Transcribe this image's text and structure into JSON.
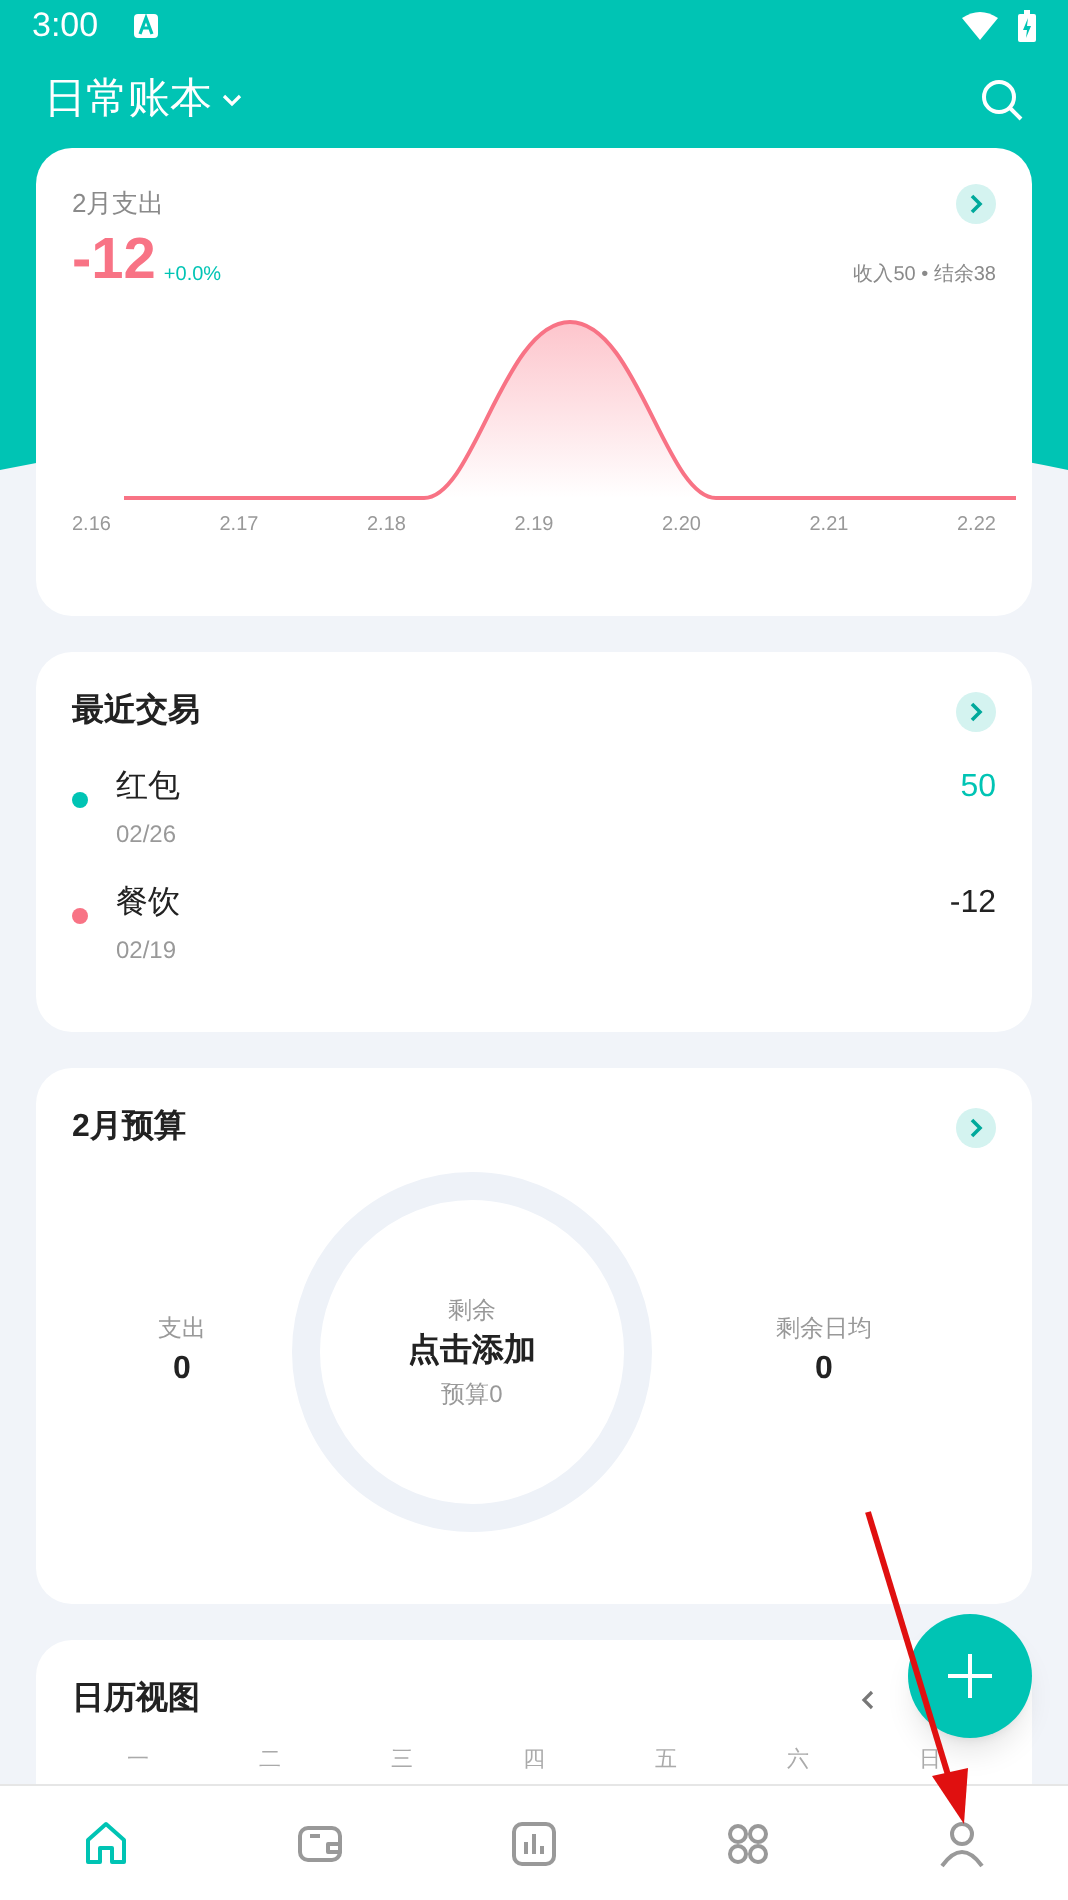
{
  "status_bar": {
    "time": "3:00"
  },
  "header": {
    "title": "日常账本"
  },
  "expense_card": {
    "title": "2月支出",
    "amount": "-12",
    "change": "+0.0%",
    "summary": "收入50 • 结余38",
    "x_labels": [
      "2.16",
      "2.17",
      "2.18",
      "2.19",
      "2.20",
      "2.21",
      "2.22"
    ]
  },
  "recent": {
    "title": "最近交易",
    "items": [
      {
        "name": "红包",
        "date": "02/26",
        "amount": "50",
        "color": "#00c4b4"
      },
      {
        "name": "餐饮",
        "date": "02/19",
        "amount": "-12",
        "color": "#f87385"
      }
    ]
  },
  "budget": {
    "title": "2月预算",
    "left": {
      "label": "支出",
      "value": "0"
    },
    "center": {
      "label": "剩余",
      "action": "点击添加",
      "sub": "预算0"
    },
    "right": {
      "label": "剩余日均",
      "value": "0"
    }
  },
  "calendar": {
    "title": "日历视图",
    "weekdays": [
      "一",
      "二",
      "三",
      "四",
      "五",
      "六",
      "日"
    ]
  },
  "nav": [
    {
      "kind": "home",
      "selected": true
    },
    {
      "kind": "wallet",
      "selected": false
    },
    {
      "kind": "chart",
      "selected": false
    },
    {
      "kind": "apps",
      "selected": false
    },
    {
      "kind": "person",
      "selected": false
    }
  ]
}
